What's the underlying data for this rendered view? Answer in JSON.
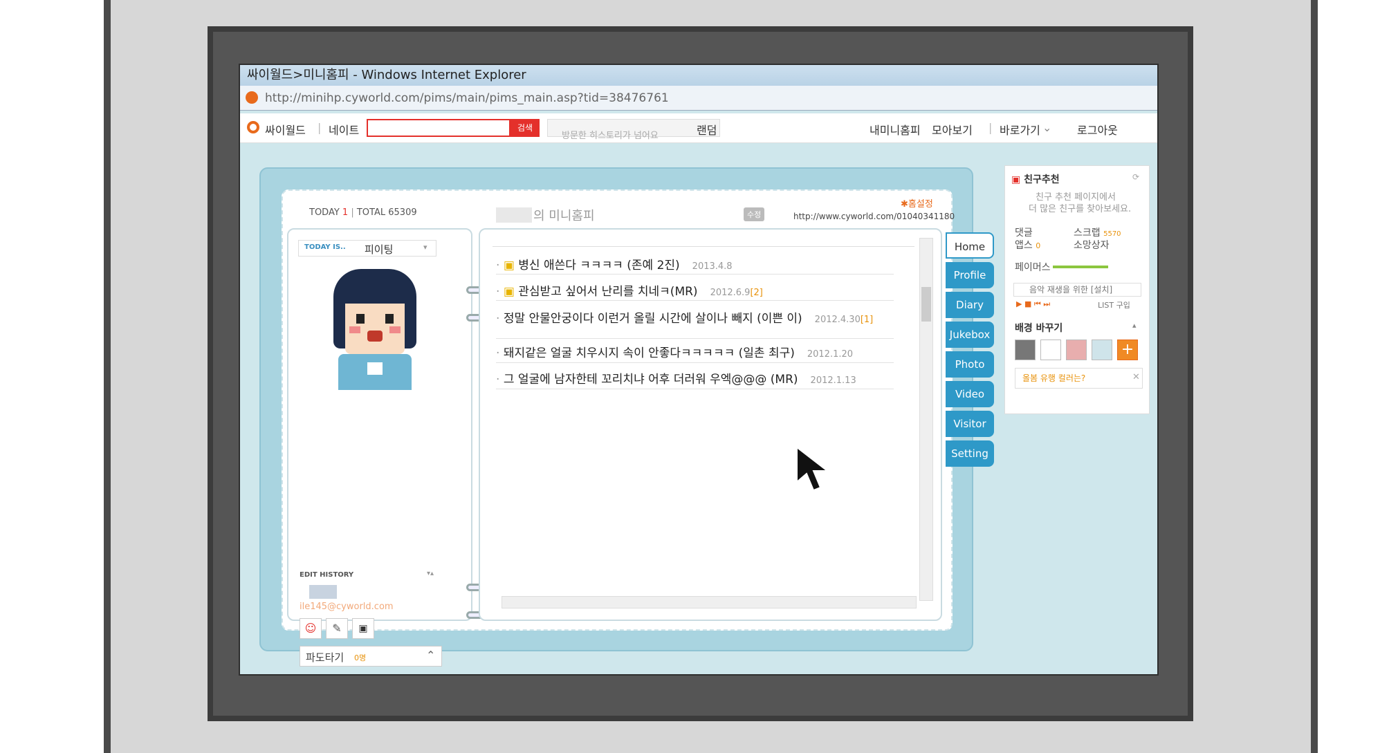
{
  "browser": {
    "title": "싸이월드>미니홈피 - Windows Internet Explorer",
    "url": "http://minihp.cyworld.com/pims/main/pims_main.asp?tid=38476761"
  },
  "topnav": {
    "brand": "싸이월드",
    "nate": "네이트",
    "search_button": "검색",
    "history_placeholder": "방문한 히스토리가 넘어요",
    "random": "랜덤",
    "my_minihompy": "내미니홈피",
    "collect": "모아보기",
    "shortcut": "바로가기",
    "logout": "로그아웃"
  },
  "minihompy": {
    "today_label": "TODAY",
    "today_count": "1",
    "total_label": "TOTAL",
    "total_count": "65309",
    "title": "의 미니홈피",
    "edit_button": "수정",
    "settings_link": "홈설정",
    "home_url": "http://www.cyworld.com/01040341180",
    "today_is_label": "TODAY IS..",
    "mood": "피이팅",
    "edit_history": "EDIT  HISTORY",
    "email": "ile145@cyworld.com",
    "wave_label": "파도타기",
    "wave_count": "0명"
  },
  "posts": [
    {
      "title": "병신 애쓴다 ㅋㅋㅋㅋ (존예 2진)",
      "date": "2013.4.8",
      "count": ""
    },
    {
      "title": "관심받고 싶어서 난리를 치네ㅋ(MR)",
      "date": "2012.6.9",
      "count": "[2]"
    },
    {
      "title": "정말 안물안궁이다 이런거 올릴 시간에 살이나 빼지 (이쁜 이)",
      "date": "2012.4.30",
      "count": "[1]"
    },
    {
      "title": "돼지같은 얼굴 치우시지 속이 안좋다ㅋㅋㅋㅋㅋ (일촌 최구)",
      "date": "2012.1.20",
      "count": ""
    },
    {
      "title": "그 얼굴에 남자한테 꼬리치냐 어후 더러워 우엑@@@ (MR)",
      "date": "2012.1.13",
      "count": ""
    }
  ],
  "tabs": [
    "Home",
    "Profile",
    "Diary",
    "Jukebox",
    "Photo",
    "Video",
    "Visitor",
    "Setting"
  ],
  "right_panel": {
    "friend_recommend": "친구추천",
    "recommend_text_1": "친구 추천 페이지에서",
    "recommend_text_2": "더 많은 친구를 찾아보세요.",
    "comment_label": "댓글",
    "apps_label": "앱스",
    "apps_count": "0",
    "scrap_label": "스크랩",
    "scrap_count": "5570",
    "wish_box": "소망상자",
    "face_label": "페이머스",
    "music_label": "음악 재생을 위한 [설치]",
    "music_list": "LIST 구입",
    "bg_change": "배경 바꾸기",
    "tooltip": "올봄 유행 컬러는?"
  },
  "colors": {
    "accent_blue": "#2e99c8",
    "brand_orange": "#e86a1c",
    "search_red": "#e4302b"
  }
}
